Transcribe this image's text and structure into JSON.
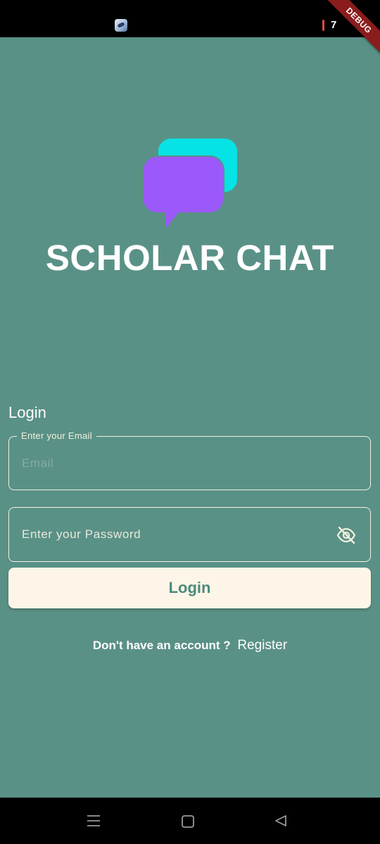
{
  "status_bar": {
    "app_icon": "app-notification-icon",
    "battery_level": "7",
    "battery_color": "#e24a3b"
  },
  "debug_banner": "DEBUG",
  "brand": {
    "logo": "chat-bubbles-logo",
    "logo_colors": {
      "back_bubble": "#06e3e5",
      "front_bubble": "#9b59fb"
    },
    "title": "SCHOLAR CHAT"
  },
  "form": {
    "title": "Login",
    "email": {
      "label": "Enter your Email",
      "placeholder": "Email",
      "value": ""
    },
    "password": {
      "placeholder": "Enter your Password",
      "value": "",
      "visibility_icon": "visibility-off-icon"
    },
    "submit_label": "Login"
  },
  "register": {
    "prompt": "Don't have an account ?",
    "link": "Register"
  },
  "navigation_bar": {
    "items": [
      "menu-icon",
      "home-square-icon",
      "back-triangle-icon"
    ]
  },
  "colors": {
    "background": "#5a9187",
    "button_background": "#fdf6e8",
    "button_text": "#4d8a7f",
    "field_border": "#f3f0dc"
  }
}
